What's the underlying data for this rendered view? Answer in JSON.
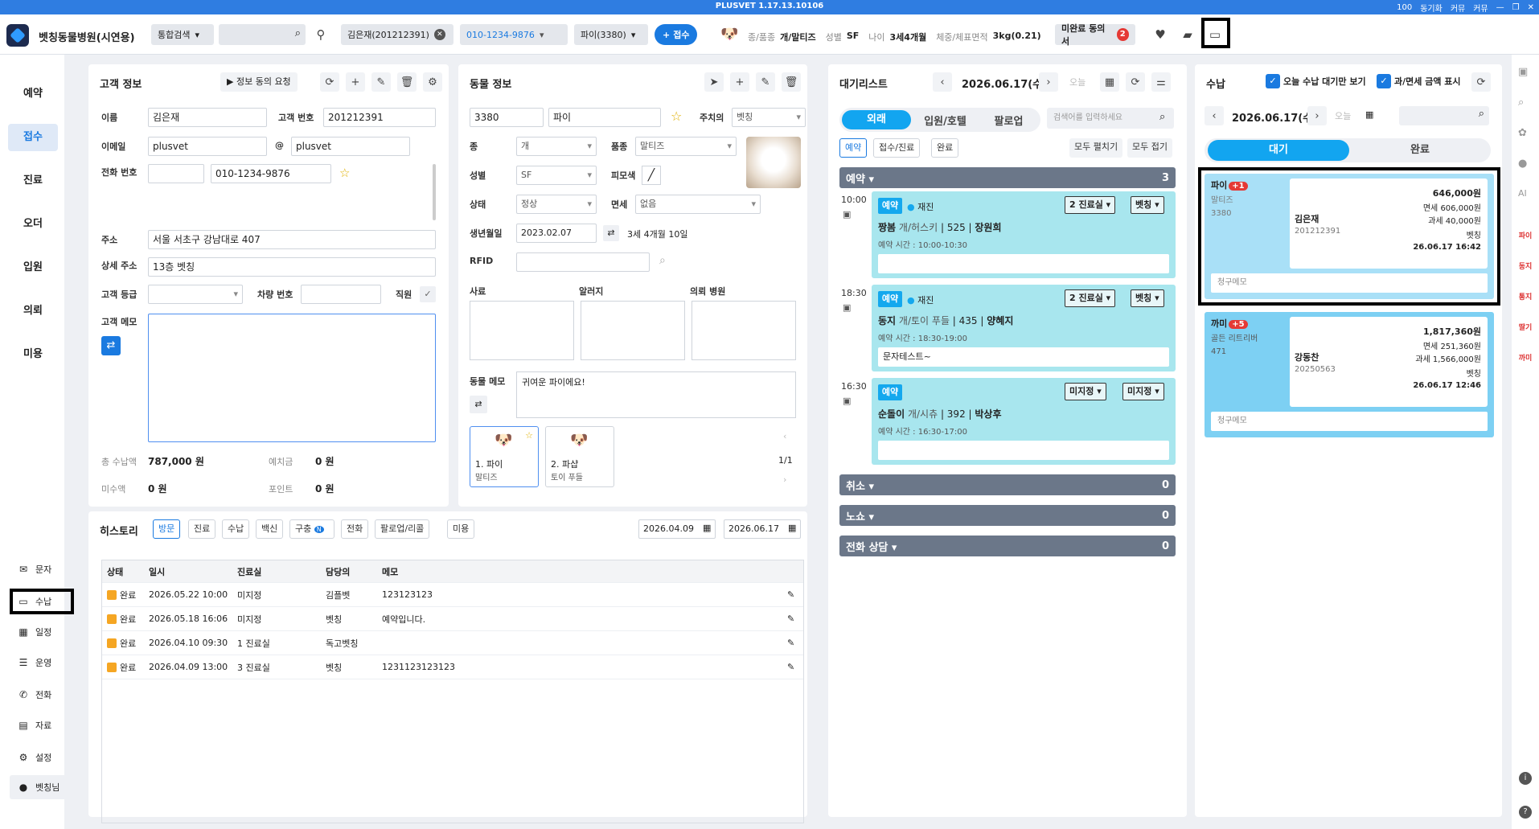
{
  "titlebar": {
    "title": "PLUSVET 1.17.13.10106",
    "zoom": "100",
    "items": [
      "동기화",
      "커뮤",
      "커뮤"
    ]
  },
  "header": {
    "hospital": "벳칭동물병원(시연용)",
    "search_type": "통합검색",
    "client_chip": "김은재(201212391)",
    "phone_chip": "010-1234-9876",
    "pet_chip": "파이(3380)",
    "reception_btn": "접수",
    "breed_label": "종/품종",
    "breed_value": "개/말티즈",
    "sex_label": "성별",
    "sex_value": "SF",
    "age_label": "나이",
    "age_value": "3세4개월",
    "weight_label": "체중/체표면적",
    "weight_value": "3kg(0.21)",
    "consent_label": "미완료 동의서",
    "consent_count": "2"
  },
  "leftnav": {
    "main": [
      "예약",
      "접수",
      "진료",
      "오더",
      "입원",
      "의뢰",
      "미용"
    ],
    "sub": [
      "문자",
      "수납",
      "일정",
      "운영",
      "전화",
      "자료",
      "설정",
      "벳칭님"
    ]
  },
  "customer": {
    "title": "고객 정보",
    "consent_btn": "정보 동의 요청",
    "name_label": "이름",
    "name": "김은재",
    "cust_no_label": "고객 번호",
    "cust_no": "201212391",
    "email_label": "이메일",
    "email_id": "plusvet",
    "at": "@",
    "email_domain": "plusvet",
    "phone_label": "전화 번호",
    "phone": "010-1234-9876",
    "addr_label": "주소",
    "addr": "서울 서초구 강남대로 407",
    "addr2_label": "상세 주소",
    "addr2": "13층 벳칭",
    "grade_label": "고객 등급",
    "car_label": "차량 번호",
    "staff_label": "직원",
    "memo_label": "고객 메모",
    "total_label": "총 수납액",
    "total": "787,000 원",
    "deposit_label": "예치금",
    "deposit": "0 원",
    "unpaid_label": "미수액",
    "unpaid": "0 원",
    "point_label": "포인트",
    "point": "0 원"
  },
  "animal": {
    "title": "동물 정보",
    "chart_no": "3380",
    "name": "파이",
    "vet_label": "주치의",
    "vet": "벳칭",
    "species_label": "종",
    "species": "개",
    "breed_label": "품종",
    "breed": "말티즈",
    "sex_label": "성별",
    "sex": "SF",
    "coat_label": "피모색",
    "status_label": "상태",
    "status": "정상",
    "tax_label": "면세",
    "tax": "없음",
    "birth_label": "생년월일",
    "birth": "2023.02.07",
    "age": "3세 4개월 10일",
    "rfid_label": "RFID",
    "photo_label": "사료",
    "allergy_label": "알러지",
    "referral_label": "의뢰 병원",
    "memo_label": "동물 메모",
    "memo": "귀여운 파이에요!",
    "pets": [
      {
        "label": "1. 파이",
        "breed": "말티즈"
      },
      {
        "label": "2. 파샵",
        "breed": "토이 푸들"
      }
    ],
    "pager": "1/1"
  },
  "history": {
    "title": "히스토리",
    "tabs": [
      "방문",
      "진료",
      "수납",
      "백신",
      "구충",
      "전화",
      "팔로업/리콜",
      "미용"
    ],
    "new_badge": "N",
    "date_from": "2026.04.09",
    "date_to": "2026.06.17",
    "columns": [
      "상태",
      "일시",
      "진료실",
      "담당의",
      "메모"
    ],
    "rows": [
      [
        "완료",
        "2026.05.22 10:00",
        "미지정",
        "김플벳",
        "123123123"
      ],
      [
        "완료",
        "2026.05.18 16:06",
        "미지정",
        "벳칭",
        "예약입니다."
      ],
      [
        "완료",
        "2026.04.10 09:30",
        "1 진료실",
        "독고벳칭",
        ""
      ],
      [
        "완료",
        "2026.04.09 13:00",
        "3 진료실",
        "벳칭",
        "1231123123123"
      ]
    ]
  },
  "waitlist": {
    "title": "대기리스트",
    "date": "2026.06.17(수)",
    "today": "오늘",
    "tabs": [
      "외래",
      "입원/호텔",
      "팔로업"
    ],
    "search_placeholder": "검색어를 입력하세요",
    "subtabs": [
      "예약",
      "접수/진료",
      "완료"
    ],
    "expand_all": "모두 펼치기",
    "collapse_all": "모두 접기",
    "group_reserve": "예약",
    "group_reserve_count": "3",
    "appts": [
      {
        "time": "10:00",
        "badge": "예약",
        "kind": "재진",
        "room": "2 진료실",
        "vet": "벳칭",
        "pet": "짱봄",
        "breed": "개/허스키",
        "no": "525",
        "owner": "장원희",
        "period": "예약 시간 : 10:00-10:30",
        "memo": ""
      },
      {
        "time": "18:30",
        "badge": "예약",
        "kind": "재진",
        "room": "2 진료실",
        "vet": "벳칭",
        "pet": "동지",
        "breed": "개/토이 푸들",
        "no": "435",
        "owner": "양혜지",
        "period": "예약 시간 : 18:30-19:00",
        "memo": "문자테스트~"
      },
      {
        "time": "16:30",
        "badge": "예약",
        "kind": "",
        "room": "미지정",
        "vet": "미지정",
        "pet": "순돌이",
        "breed": "개/시츄",
        "no": "392",
        "owner": "박상후",
        "period": "예약 시간 : 16:30-17:00",
        "memo": ""
      }
    ],
    "groups": [
      {
        "name": "취소",
        "count": "0"
      },
      {
        "name": "노쇼",
        "count": "0"
      },
      {
        "name": "전화 상담",
        "count": "0"
      }
    ]
  },
  "payment": {
    "title": "수납",
    "chk1": "오늘 수납 대기만 보기",
    "chk2": "과/면세 금액 표시",
    "date": "2026.06.17(수)",
    "today": "오늘",
    "tabs": [
      "대기",
      "완료"
    ],
    "cards": [
      {
        "pet": "파이",
        "badge": "+1",
        "breed": "말티즈",
        "chart": "3380",
        "owner": "김은재",
        "owner_no": "201212391",
        "total": "646,000원",
        "free": "면세 606,000원",
        "tax": "과세 40,000원",
        "vet": "벳칭",
        "time": "26.06.17 16:42",
        "memo_label": "청구메모"
      },
      {
        "pet": "까미",
        "badge": "+5",
        "breed": "골든 리트리버",
        "chart": "471",
        "owner": "강동찬",
        "owner_no": "20250563",
        "total": "1,817,360원",
        "free": "면세 251,360원",
        "tax": "과세 1,566,000원",
        "vet": "벳칭",
        "time": "26.06.17 12:46",
        "memo_label": "청구메모"
      }
    ]
  },
  "rightbar": {
    "labels": [
      "파이",
      "동지",
      "통지",
      "딸기",
      "까미"
    ]
  }
}
